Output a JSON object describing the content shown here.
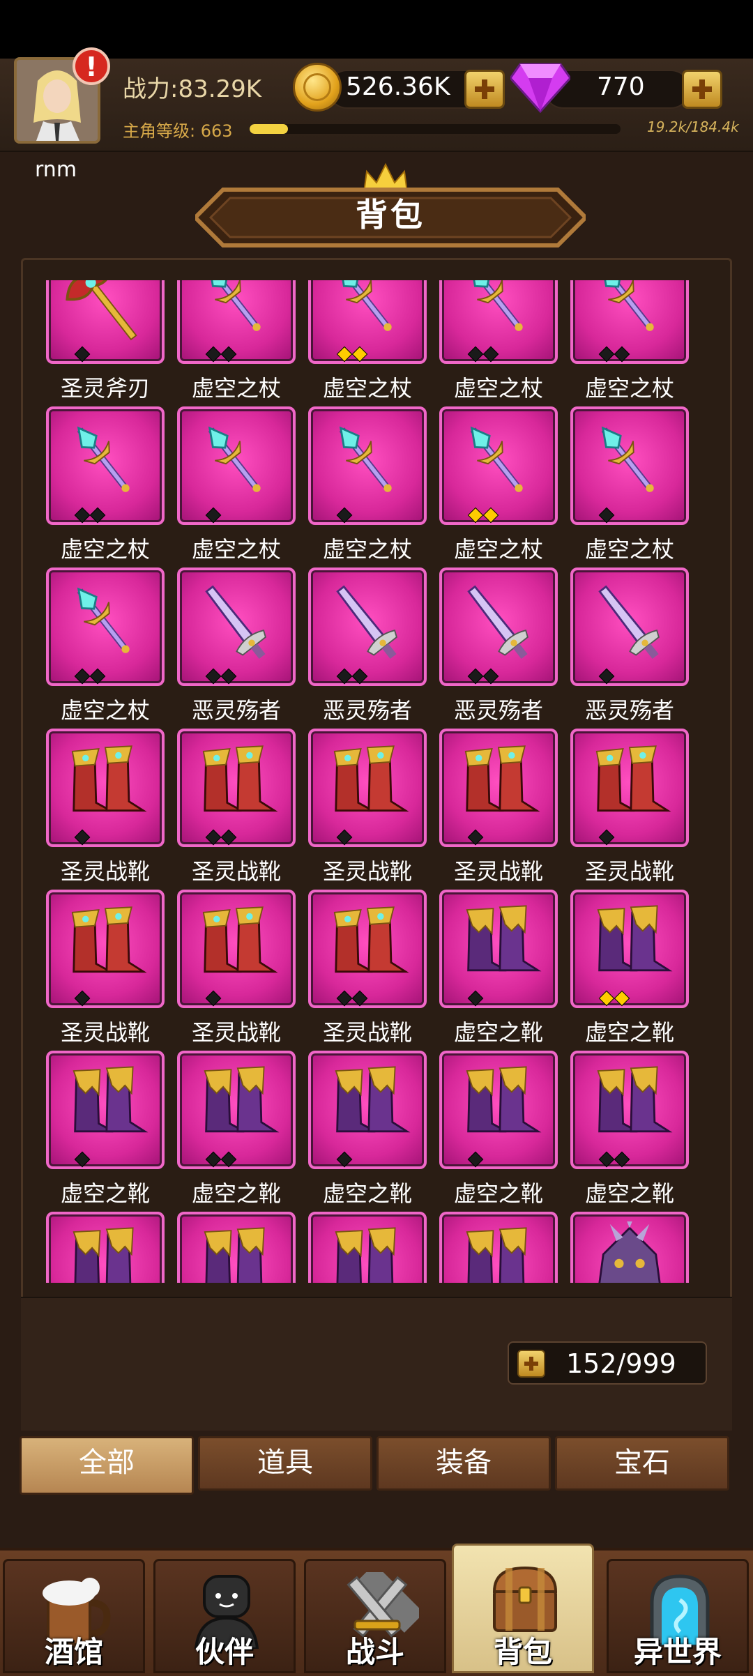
{
  "header": {
    "username": "rnm",
    "power": "战力:83.29K",
    "level_label": "主角等级: 663",
    "xp_text": "19.2k/184.4k",
    "xp_fraction": 0.104,
    "gold": "526.36K",
    "gems": "770",
    "alert_mark": "!"
  },
  "page": {
    "title": "背包"
  },
  "inventory": {
    "capacity": "152/999",
    "items": [
      {
        "name": "圣灵斧刃",
        "icon": "axe-icon",
        "pips": [
          "dark"
        ]
      },
      {
        "name": "虚空之杖",
        "icon": "staff-icon",
        "pips": [
          "dark",
          "dark"
        ]
      },
      {
        "name": "虚空之杖",
        "icon": "staff-icon",
        "pips": [
          "gold",
          "gold"
        ]
      },
      {
        "name": "虚空之杖",
        "icon": "staff-icon",
        "pips": [
          "dark",
          "dark"
        ]
      },
      {
        "name": "虚空之杖",
        "icon": "staff-icon",
        "pips": [
          "dark",
          "dark"
        ]
      },
      {
        "name": "虚空之杖",
        "icon": "staff-icon",
        "pips": [
          "dark",
          "dark"
        ]
      },
      {
        "name": "虚空之杖",
        "icon": "staff-icon",
        "pips": [
          "dark"
        ]
      },
      {
        "name": "虚空之杖",
        "icon": "staff-icon",
        "pips": [
          "dark"
        ]
      },
      {
        "name": "虚空之杖",
        "icon": "staff-icon",
        "pips": [
          "gold",
          "gold"
        ]
      },
      {
        "name": "虚空之杖",
        "icon": "staff-icon",
        "pips": [
          "dark"
        ]
      },
      {
        "name": "虚空之杖",
        "icon": "staff-icon",
        "pips": [
          "dark",
          "dark"
        ]
      },
      {
        "name": "恶灵殇者",
        "icon": "sword-icon",
        "pips": [
          "dark",
          "dark"
        ]
      },
      {
        "name": "恶灵殇者",
        "icon": "sword-icon",
        "pips": [
          "dark",
          "dark"
        ]
      },
      {
        "name": "恶灵殇者",
        "icon": "sword-icon",
        "pips": [
          "dark",
          "dark"
        ]
      },
      {
        "name": "恶灵殇者",
        "icon": "sword-icon",
        "pips": [
          "dark"
        ]
      },
      {
        "name": "圣灵战靴",
        "icon": "red-boots-icon",
        "pips": [
          "dark"
        ]
      },
      {
        "name": "圣灵战靴",
        "icon": "red-boots-icon",
        "pips": [
          "dark",
          "dark"
        ]
      },
      {
        "name": "圣灵战靴",
        "icon": "red-boots-icon",
        "pips": [
          "dark"
        ]
      },
      {
        "name": "圣灵战靴",
        "icon": "red-boots-icon",
        "pips": [
          "dark"
        ]
      },
      {
        "name": "圣灵战靴",
        "icon": "red-boots-icon",
        "pips": [
          "dark"
        ]
      },
      {
        "name": "圣灵战靴",
        "icon": "red-boots-icon",
        "pips": [
          "dark"
        ]
      },
      {
        "name": "圣灵战靴",
        "icon": "red-boots-icon",
        "pips": [
          "dark"
        ]
      },
      {
        "name": "圣灵战靴",
        "icon": "red-boots-icon",
        "pips": [
          "dark",
          "dark"
        ]
      },
      {
        "name": "虚空之靴",
        "icon": "purple-boots-icon",
        "pips": [
          "dark"
        ]
      },
      {
        "name": "虚空之靴",
        "icon": "purple-boots-icon",
        "pips": [
          "gold",
          "gold"
        ]
      },
      {
        "name": "虚空之靴",
        "icon": "purple-boots-icon",
        "pips": [
          "dark"
        ]
      },
      {
        "name": "虚空之靴",
        "icon": "purple-boots-icon",
        "pips": [
          "dark",
          "dark"
        ]
      },
      {
        "name": "虚空之靴",
        "icon": "purple-boots-icon",
        "pips": [
          "dark"
        ]
      },
      {
        "name": "虚空之靴",
        "icon": "purple-boots-icon",
        "pips": [
          "dark"
        ]
      },
      {
        "name": "虚空之靴",
        "icon": "purple-boots-icon",
        "pips": [
          "dark",
          "dark"
        ]
      },
      {
        "name": "",
        "icon": "purple-boots-icon",
        "pips": []
      },
      {
        "name": "",
        "icon": "purple-boots-icon",
        "pips": []
      },
      {
        "name": "",
        "icon": "purple-boots-icon",
        "pips": []
      },
      {
        "name": "",
        "icon": "purple-boots-icon",
        "pips": []
      },
      {
        "name": "",
        "icon": "spiked-armor-icon",
        "pips": []
      }
    ]
  },
  "filter_tabs": [
    {
      "label": "全部",
      "active": true
    },
    {
      "label": "道具",
      "active": false
    },
    {
      "label": "装备",
      "active": false
    },
    {
      "label": "宝石",
      "active": false
    }
  ],
  "bottom_nav": [
    {
      "label": "酒馆",
      "icon": "beer-mug-icon",
      "active": false
    },
    {
      "label": "伙伴",
      "icon": "partner-silhouette-icon",
      "active": false
    },
    {
      "label": "战斗",
      "icon": "crossed-swords-icon",
      "active": false
    },
    {
      "label": "背包",
      "icon": "treasure-chest-icon",
      "active": true
    },
    {
      "label": "异世界",
      "icon": "portal-icon",
      "active": false
    }
  ],
  "colors": {
    "card_magenta": "#d8289a",
    "card_border": "#f067c8",
    "gold_accent": "#f3d241"
  }
}
